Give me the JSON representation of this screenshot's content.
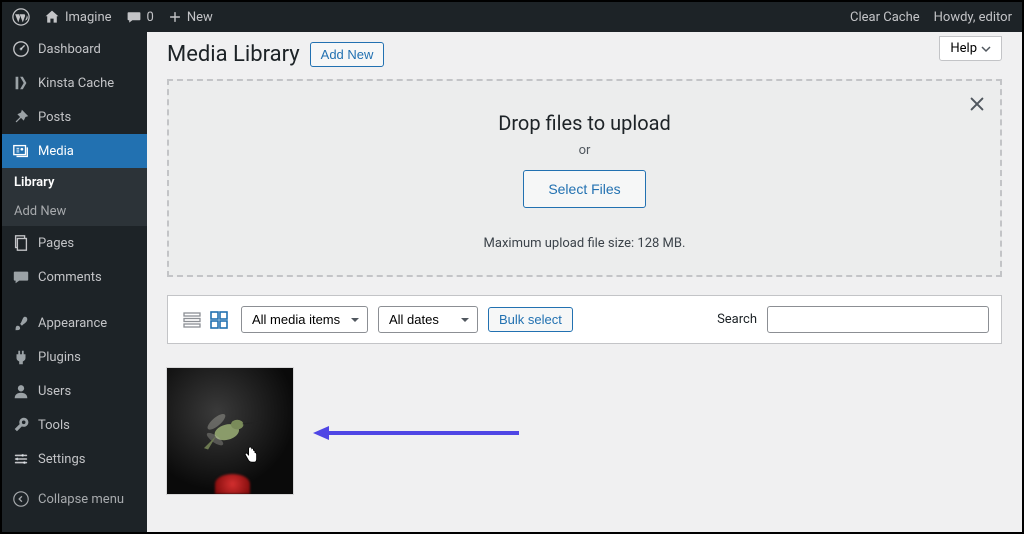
{
  "adminbar": {
    "site_name": "Imagine",
    "comment_count": "0",
    "new_label": "New",
    "clear_cache": "Clear Cache",
    "howdy": "Howdy, editor"
  },
  "sidebar": {
    "items": [
      {
        "label": "Dashboard",
        "icon": "dashboard"
      },
      {
        "label": "Kinsta Cache",
        "icon": "kinsta"
      },
      {
        "label": "Posts",
        "icon": "pin"
      },
      {
        "label": "Media",
        "icon": "media",
        "current": true
      },
      {
        "label": "Pages",
        "icon": "pages"
      },
      {
        "label": "Comments",
        "icon": "comments"
      },
      {
        "label": "Appearance",
        "icon": "brush"
      },
      {
        "label": "Plugins",
        "icon": "plug"
      },
      {
        "label": "Users",
        "icon": "user"
      },
      {
        "label": "Tools",
        "icon": "wrench"
      },
      {
        "label": "Settings",
        "icon": "settings"
      }
    ],
    "submenu": {
      "library": "Library",
      "add_new": "Add New"
    },
    "collapse": "Collapse menu"
  },
  "header": {
    "title": "Media Library",
    "add_new": "Add New",
    "help": "Help"
  },
  "dropzone": {
    "heading": "Drop files to upload",
    "or": "or",
    "select_files": "Select Files",
    "max_size": "Maximum upload file size: 128 MB."
  },
  "filters": {
    "media_type": "All media items",
    "dates": "All dates",
    "bulk_select": "Bulk select",
    "search_label": "Search"
  }
}
